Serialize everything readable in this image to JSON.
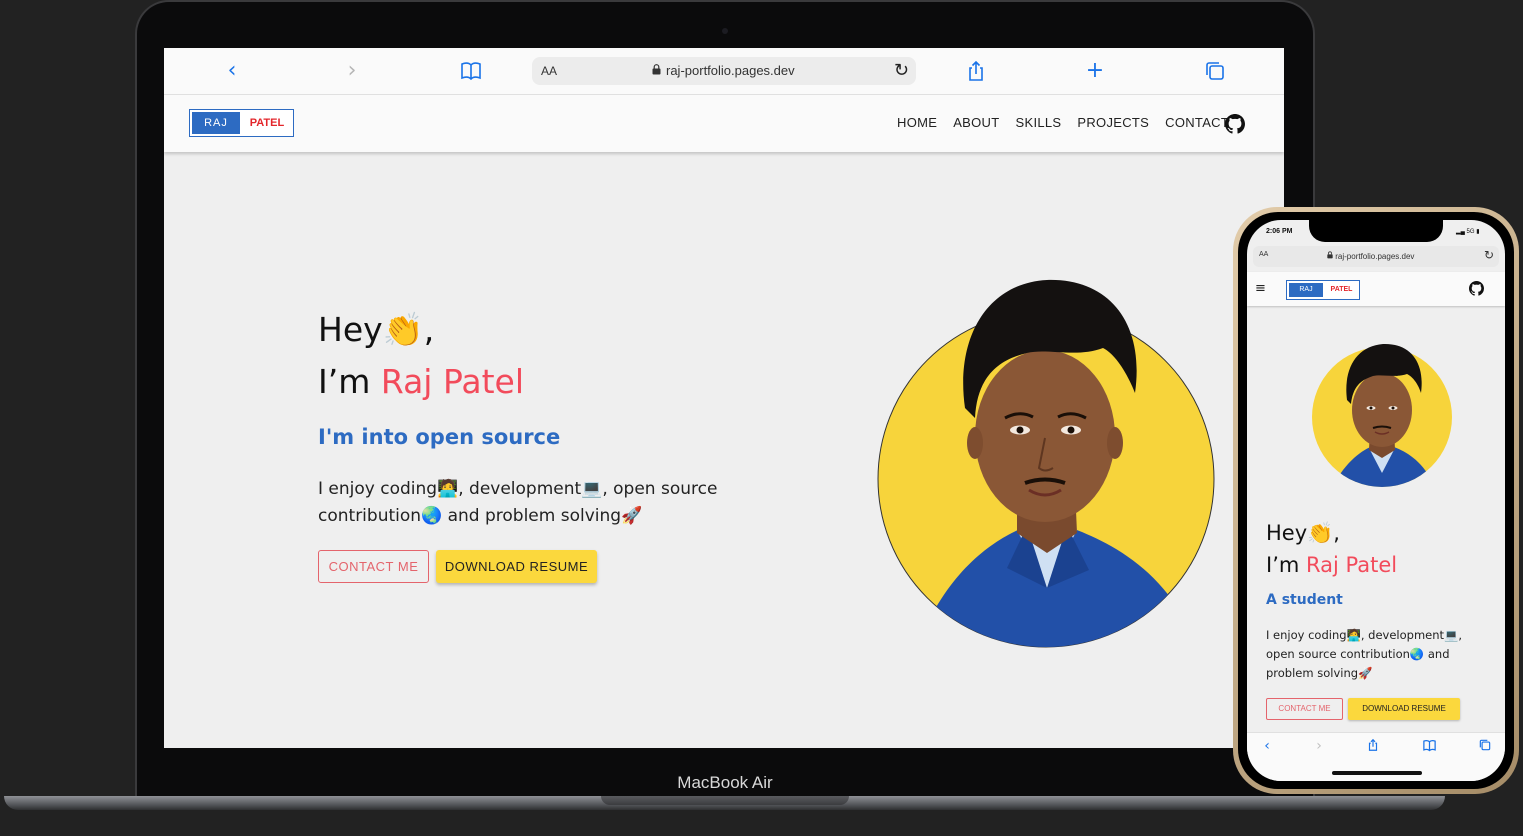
{
  "laptop": {
    "model_label": "MacBook Air",
    "browser": {
      "aa_label": "AA",
      "url": "raj-portfolio.pages.dev",
      "icons": [
        "back-icon",
        "forward-icon",
        "bookmarks-icon",
        "lock-icon",
        "reload-icon",
        "share-icon",
        "new-tab-icon",
        "tabs-icon"
      ]
    },
    "site": {
      "logo": {
        "first": "RAJ",
        "last": "PATEL"
      },
      "nav": [
        "HOME",
        "ABOUT",
        "SKILLS",
        "PROJECTS",
        "CONTACT"
      ],
      "hero": {
        "greeting": "Hey👏,",
        "intro": "I’m ",
        "name": "Raj Patel",
        "tagline": "I'm into open source",
        "description": "I enjoy coding🧑‍💻, development💻, open source contribution🌏 and problem solving🚀",
        "contact_button": "CONTACT ME",
        "resume_button": "DOWNLOAD RESUME"
      }
    }
  },
  "phone": {
    "status": {
      "time": "2:06 PM",
      "signal": "5G"
    },
    "browser": {
      "aa_label": "AA",
      "url": "raj-portfolio.pages.dev"
    },
    "site": {
      "logo": {
        "first": "RAJ",
        "last": "PATEL"
      },
      "hero": {
        "greeting": "Hey👏,",
        "intro": "I’m ",
        "name": "Raj Patel",
        "tagline": "A student",
        "description": "I enjoy coding🧑‍💻, development💻, open source contribution🌏 and problem solving🚀",
        "contact_button": "CONTACT ME",
        "resume_button": "DOWNLOAD RESUME"
      }
    }
  },
  "colors": {
    "accent_blue": "#2d6bc2",
    "accent_red": "#f24b5b",
    "button_yellow": "#fbd83d",
    "portrait_circle": "#f7d43b",
    "page_bg": "#efefef"
  }
}
